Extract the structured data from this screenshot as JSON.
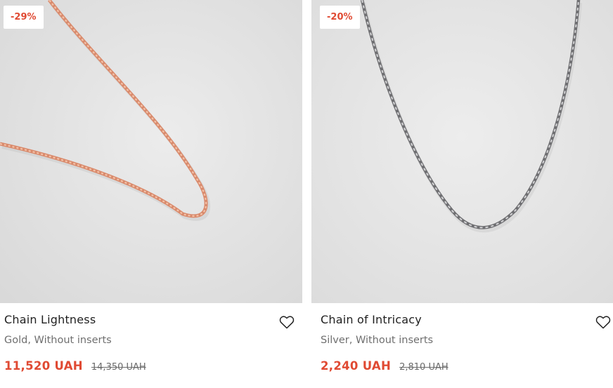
{
  "products": [
    {
      "discount": "-29%",
      "name": "Chain Lightness",
      "attributes": "Gold, Without inserts",
      "price": "11,520 UAH",
      "old_price": "14,350 UAH",
      "image_icon": "rose-gold-chain-photo",
      "favorite_icon": "heart-outline-icon"
    },
    {
      "discount": "-20%",
      "name": "Chain of Intricacy",
      "attributes": "Silver, Without inserts",
      "price": "2,240 UAH",
      "old_price": "2,810 UAH",
      "image_icon": "silver-rope-chain-photo",
      "favorite_icon": "heart-outline-icon"
    }
  ],
  "colors": {
    "accent_price": "#e04a33",
    "text_primary": "#1f1f1f",
    "text_secondary": "#6f6f6f",
    "photo_background": "#e3e3e3"
  }
}
